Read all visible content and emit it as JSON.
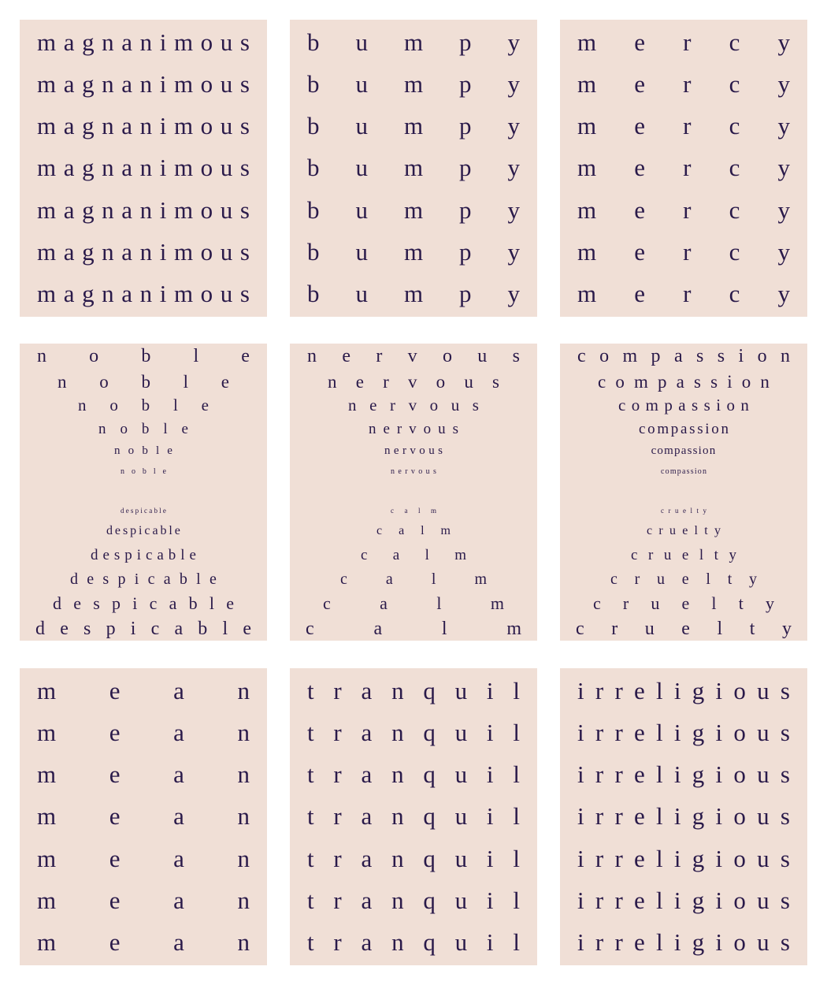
{
  "tiles": [
    {
      "kind": "uniform",
      "word": "magnanimous",
      "repeat": 7
    },
    {
      "kind": "uniform",
      "word": "bumpy",
      "repeat": 7
    },
    {
      "kind": "uniform",
      "word": "mercy",
      "repeat": 7
    },
    {
      "kind": "gradient",
      "top_word": "noble",
      "bottom_word": "despicable"
    },
    {
      "kind": "gradient",
      "top_word": "nervous",
      "bottom_word": "calm"
    },
    {
      "kind": "gradient",
      "top_word": "compassion",
      "bottom_word": "cruelty"
    },
    {
      "kind": "uniform",
      "word": "mean",
      "repeat": 7
    },
    {
      "kind": "uniform",
      "word": "tranquil",
      "repeat": 7
    },
    {
      "kind": "uniform",
      "word": "irreligious",
      "repeat": 7
    }
  ],
  "colors": {
    "tile_bg": "#f0dfd6",
    "text": "#2a1a4a",
    "page_bg": "#ffffff"
  }
}
